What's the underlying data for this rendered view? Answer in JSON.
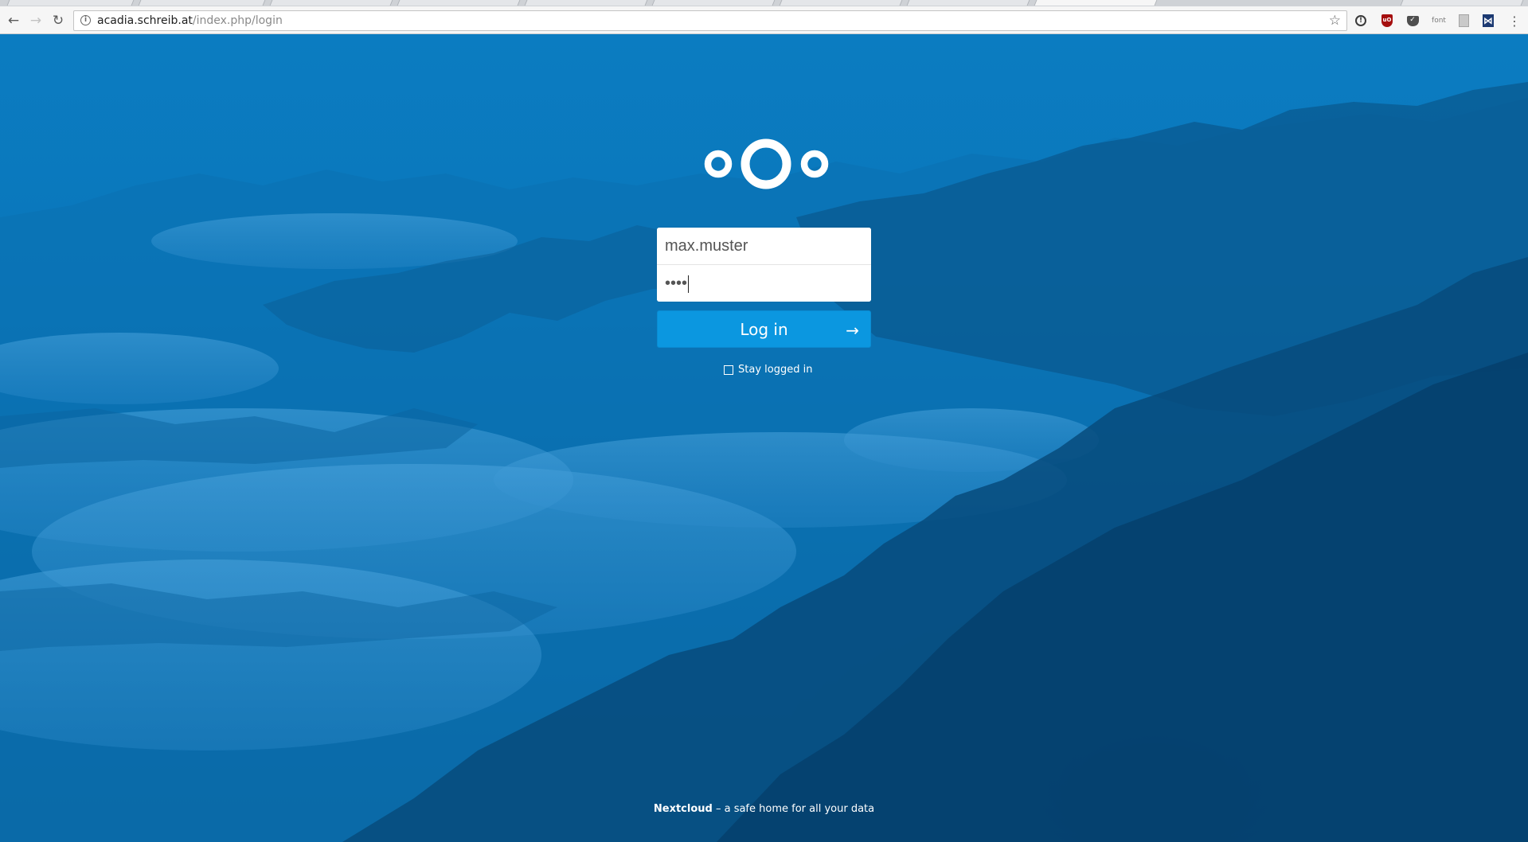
{
  "browser": {
    "url_host": "acadia.schreib.at",
    "url_path": "/index.php/login",
    "extensions": [
      "info-icon",
      "ublock-icon",
      "pocket-icon",
      "font-icon",
      "page-icon",
      "bookmark-icon",
      "menu-icon"
    ],
    "ext_font_label": "font",
    "ublock_label": "uO"
  },
  "login": {
    "username_value": "max.muster",
    "password_mask": "••••",
    "login_label": "Log in",
    "stay_logged_in_label": "Stay logged in"
  },
  "footer": {
    "brand": "Nextcloud",
    "tagline": " – a safe home for all your data"
  },
  "colors": {
    "background": "#0a77bb",
    "button": "#0b97e0",
    "field": "#ffffff"
  }
}
